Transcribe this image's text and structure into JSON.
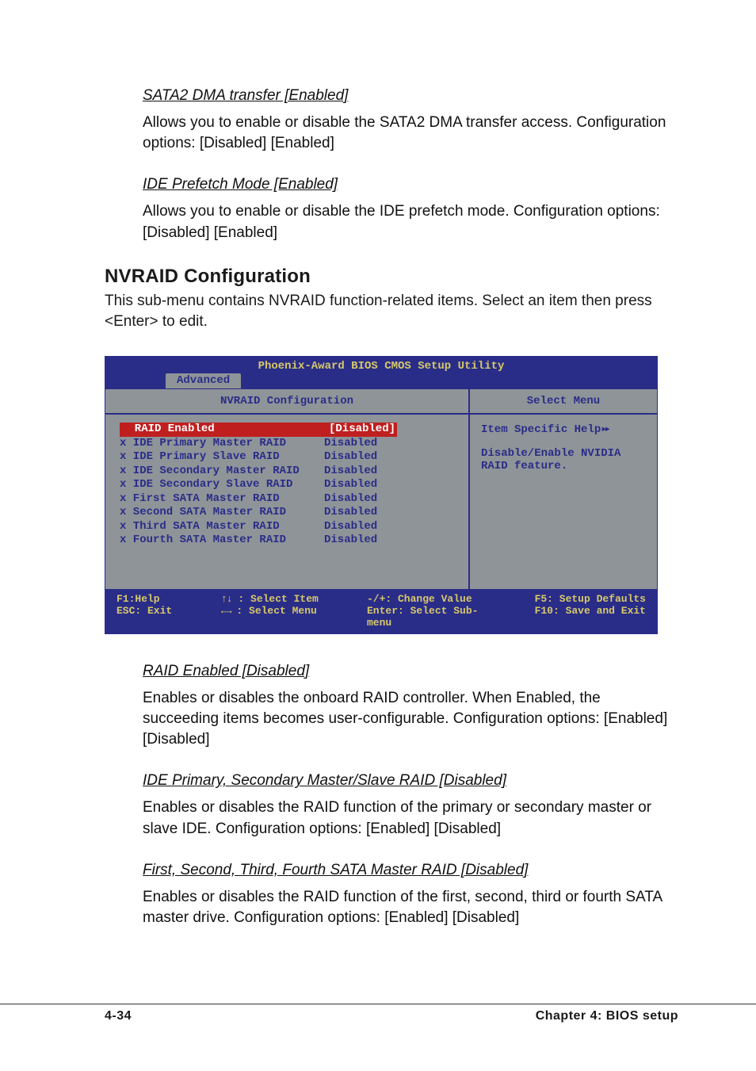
{
  "sec1": {
    "head": "SATA2 DMA transfer [Enabled]",
    "body": "Allows you to enable or disable the SATA2 DMA transfer access. Configuration options: [Disabled] [Enabled]"
  },
  "sec2": {
    "head": "IDE Prefetch Mode [Enabled]",
    "body": "Allows you to enable or disable the IDE prefetch mode. Configuration options: [Disabled] [Enabled]"
  },
  "nvraid": {
    "title": "NVRAID Configuration",
    "intro": "This sub-menu contains NVRAID function-related items. Select an item then press <Enter> to edit."
  },
  "bios": {
    "top": "Phoenix-Award BIOS CMOS Setup Utility",
    "tab": "Advanced",
    "leftTitle": "NVRAID Configuration",
    "rightTitle": "Select Menu",
    "helpHeading": "Item Specific Help",
    "helpBody1": "Disable/Enable NVIDIA",
    "helpBody2": "RAID feature.",
    "rows": [
      {
        "label": "  RAID Enabled",
        "value": "[Disabled]",
        "selected": true
      },
      {
        "label": "x IDE Primary Master RAID",
        "value": "Disabled",
        "selected": false
      },
      {
        "label": "x IDE Primary Slave RAID",
        "value": "Disabled",
        "selected": false
      },
      {
        "label": "x IDE Secondary Master RAID",
        "value": "Disabled",
        "selected": false
      },
      {
        "label": "x IDE Secondary Slave RAID",
        "value": "Disabled",
        "selected": false
      },
      {
        "label": "x First SATA Master RAID",
        "value": "Disabled",
        "selected": false
      },
      {
        "label": "x Second SATA Master RAID",
        "value": "Disabled",
        "selected": false
      },
      {
        "label": "x Third SATA Master RAID",
        "value": "Disabled",
        "selected": false
      },
      {
        "label": "x Fourth SATA Master RAID",
        "value": "Disabled",
        "selected": false
      }
    ],
    "footer": {
      "c1a": "F1:Help",
      "c1b": "ESC: Exit",
      "c2a": ": Select Item",
      "c2b": ": Select Menu",
      "c3a": "-/+: Change Value",
      "c3b": "Enter: Select Sub-menu",
      "c4a": "F5: Setup Defaults",
      "c4b": "F10: Save and Exit"
    }
  },
  "after": {
    "h1": "RAID Enabled [Disabled]",
    "b1": "Enables or disables the onboard RAID controller. When Enabled, the succeeding items becomes user-configurable. Configuration options: [Enabled] [Disabled]",
    "h2": "IDE Primary, Secondary Master/Slave RAID [Disabled]",
    "b2": "Enables or disables the RAID function of the primary or secondary master or slave IDE. Configuration options: [Enabled] [Disabled]",
    "h3": "First, Second, Third, Fourth SATA Master RAID [Disabled]",
    "b3": "Enables or disables the RAID function of the first, second, third or fourth SATA master drive. Configuration options: [Enabled] [Disabled]"
  },
  "footer": {
    "left": "4-34",
    "right": "Chapter 4: BIOS setup"
  },
  "glyphs": {
    "updown": "↑↓",
    "leftright": "←→",
    "rtri": "▸▸"
  }
}
